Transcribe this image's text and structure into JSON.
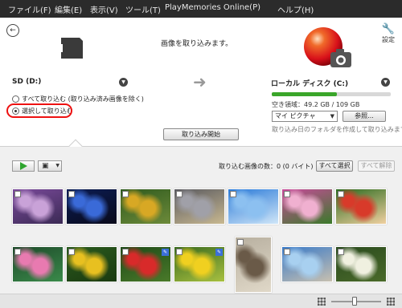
{
  "menu": [
    {
      "label": "ファイル(F)"
    },
    {
      "label": "編集(E)"
    },
    {
      "label": "表示(V)"
    },
    {
      "label": "ツール(T)"
    },
    {
      "label": "PlayMemories Online(P)"
    },
    {
      "label": "ヘルプ(H)"
    }
  ],
  "header": {
    "title": "画像を取り込みます。",
    "settings_label": "設定"
  },
  "source": {
    "label": "SD (D:)",
    "options": [
      {
        "label": "すべて取り込む (取り込み済み画像を除く)",
        "selected": false
      },
      {
        "label": "選択して取り込む",
        "selected": true
      }
    ]
  },
  "destination": {
    "label": "ローカル ディスク (C:)",
    "free_space": "空き領域：49.2 GB / 109 GB",
    "used_fraction": 0.55,
    "folder": "マイ ピクチャ",
    "browse_label": "参照...",
    "folder_hint": "取り込み日のフォルダを作成して取り込みます。"
  },
  "import_button": "取り込み開始",
  "toolbar": {
    "count_text": "取り込む画像の数：0 (0 バイト)",
    "select_all": "すべて選択",
    "deselect_all": "すべて解除"
  },
  "thumbnails": [
    {
      "subject": "purple flowers",
      "colors": [
        "#7a4a9a",
        "#c9a2d8",
        "#3b2a55"
      ],
      "tagged": false
    },
    {
      "subject": "blue night lights",
      "colors": [
        "#0b1d55",
        "#3a6ad8",
        "#0a0a1a"
      ],
      "tagged": false
    },
    {
      "subject": "yellow fruit tree",
      "colors": [
        "#2e5a1e",
        "#d8a824",
        "#6d8a3a"
      ],
      "tagged": false
    },
    {
      "subject": "grey cat",
      "colors": [
        "#5a5a60",
        "#a0a0a8",
        "#c8b890"
      ],
      "tagged": false
    },
    {
      "subject": "blue sky",
      "colors": [
        "#2a7ad8",
        "#8cc0f0",
        "#d0e6f8"
      ],
      "tagged": false
    },
    {
      "subject": "pink flowers",
      "colors": [
        "#c84a9a",
        "#f0b0d0",
        "#3a7a2a"
      ],
      "tagged": false
    },
    {
      "subject": "red flower field",
      "colors": [
        "#2a6a1e",
        "#d83a2a",
        "#f0d0a0"
      ],
      "tagged": false
    },
    {
      "subject": "pink lotus",
      "colors": [
        "#1e4a2a",
        "#e87ab0",
        "#3a8a4a"
      ],
      "tagged": false
    },
    {
      "subject": "yellow flowers",
      "colors": [
        "#2a5a1e",
        "#e8c020",
        "#1a3a10"
      ],
      "tagged": false
    },
    {
      "subject": "red flower",
      "colors": [
        "#1e4a18",
        "#d82a2a",
        "#4a7a2a"
      ],
      "tagged": true
    },
    {
      "subject": "yellow daisies",
      "colors": [
        "#3a6a1e",
        "#f0d020",
        "#a8c040"
      ],
      "tagged": true
    },
    {
      "subject": "cat on path",
      "colors": [
        "#b8b0a0",
        "#6a5a48",
        "#e0d8c8"
      ],
      "tagged": false
    },
    {
      "subject": "blue sky seascape",
      "colors": [
        "#3a7ac8",
        "#a8d0f0",
        "#c8c0b0"
      ],
      "tagged": false
    },
    {
      "subject": "white flowers",
      "colors": [
        "#2a4a1e",
        "#f0f0e0",
        "#4a6a2a"
      ],
      "tagged": false
    }
  ],
  "colors": {
    "menubar": "#2b2b2b",
    "highlight": "#ee1111",
    "storage": "#3aa62a"
  }
}
